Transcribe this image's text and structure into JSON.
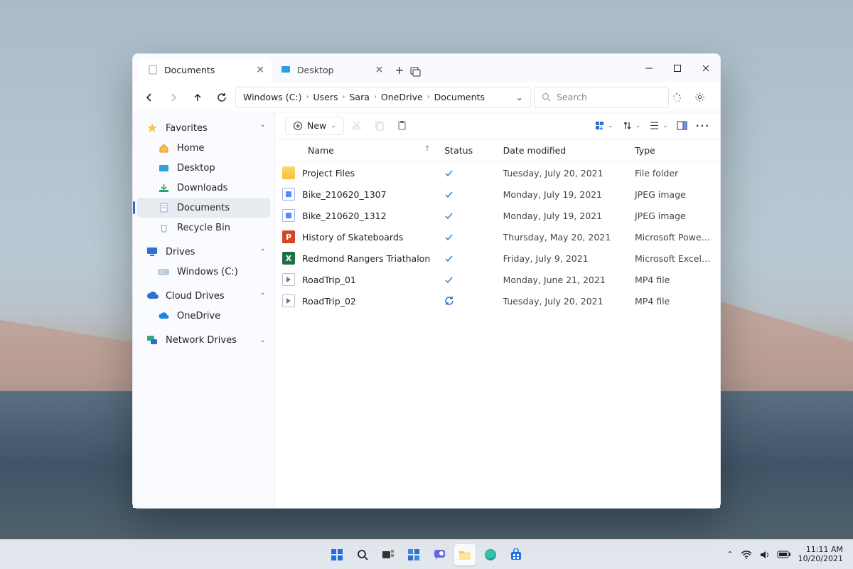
{
  "tabs": [
    {
      "label": "Documents",
      "active": true
    },
    {
      "label": "Desktop",
      "active": false
    }
  ],
  "breadcrumb": [
    "Windows (C:)",
    "Users",
    "Sara",
    "OneDrive",
    "Documents"
  ],
  "search_placeholder": "Search",
  "toolbar": {
    "new_label": "New"
  },
  "sidebar": {
    "favorites_label": "Favorites",
    "favorites": [
      "Home",
      "Desktop",
      "Downloads",
      "Documents",
      "Recycle Bin"
    ],
    "drives_label": "Drives",
    "drives": [
      "Windows (C:)"
    ],
    "cloud_label": "Cloud Drives",
    "cloud": [
      "OneDrive"
    ],
    "network_label": "Network Drives"
  },
  "columns": {
    "name": "Name",
    "status": "Status",
    "date": "Date modified",
    "type": "Type"
  },
  "files": [
    {
      "name": "Project Files",
      "status": "check",
      "date": "Tuesday, July 20, 2021",
      "type": "File folder",
      "icon": "folder"
    },
    {
      "name": "Bike_210620_1307",
      "status": "check",
      "date": "Monday, July 19, 2021",
      "type": "JPEG image",
      "icon": "jpeg"
    },
    {
      "name": "Bike_210620_1312",
      "status": "check",
      "date": "Monday, July 19, 2021",
      "type": "JPEG image",
      "icon": "jpeg"
    },
    {
      "name": "History of Skateboards",
      "status": "check",
      "date": "Thursday, May 20, 2021",
      "type": "Microsoft PowerPoi…",
      "icon": "ppt"
    },
    {
      "name": "Redmond Rangers Triathalon",
      "status": "check",
      "date": "Friday, July 9, 2021",
      "type": "Microsoft Excel Spr…",
      "icon": "xls"
    },
    {
      "name": "RoadTrip_01",
      "status": "check",
      "date": "Monday, June 21, 2021",
      "type": "MP4 file",
      "icon": "mp4"
    },
    {
      "name": "RoadTrip_02",
      "status": "sync",
      "date": "Tuesday, July 20, 2021",
      "type": "MP4 file",
      "icon": "mp4"
    }
  ],
  "systray": {
    "time": "11:11 AM",
    "date": "10/20/2021"
  }
}
